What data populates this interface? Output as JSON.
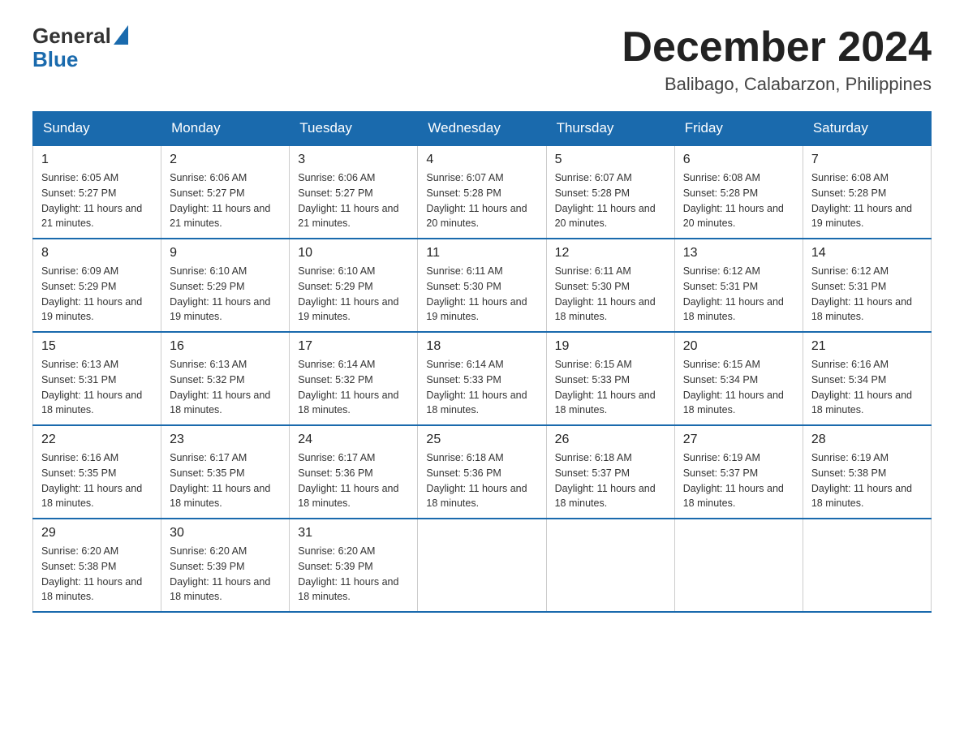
{
  "logo": {
    "general": "General",
    "triangle": "▲",
    "blue": "Blue"
  },
  "header": {
    "month": "December 2024",
    "location": "Balibago, Calabarzon, Philippines"
  },
  "weekdays": [
    "Sunday",
    "Monday",
    "Tuesday",
    "Wednesday",
    "Thursday",
    "Friday",
    "Saturday"
  ],
  "weeks": [
    [
      {
        "day": "1",
        "sunrise": "Sunrise: 6:05 AM",
        "sunset": "Sunset: 5:27 PM",
        "daylight": "Daylight: 11 hours and 21 minutes."
      },
      {
        "day": "2",
        "sunrise": "Sunrise: 6:06 AM",
        "sunset": "Sunset: 5:27 PM",
        "daylight": "Daylight: 11 hours and 21 minutes."
      },
      {
        "day": "3",
        "sunrise": "Sunrise: 6:06 AM",
        "sunset": "Sunset: 5:27 PM",
        "daylight": "Daylight: 11 hours and 21 minutes."
      },
      {
        "day": "4",
        "sunrise": "Sunrise: 6:07 AM",
        "sunset": "Sunset: 5:28 PM",
        "daylight": "Daylight: 11 hours and 20 minutes."
      },
      {
        "day": "5",
        "sunrise": "Sunrise: 6:07 AM",
        "sunset": "Sunset: 5:28 PM",
        "daylight": "Daylight: 11 hours and 20 minutes."
      },
      {
        "day": "6",
        "sunrise": "Sunrise: 6:08 AM",
        "sunset": "Sunset: 5:28 PM",
        "daylight": "Daylight: 11 hours and 20 minutes."
      },
      {
        "day": "7",
        "sunrise": "Sunrise: 6:08 AM",
        "sunset": "Sunset: 5:28 PM",
        "daylight": "Daylight: 11 hours and 19 minutes."
      }
    ],
    [
      {
        "day": "8",
        "sunrise": "Sunrise: 6:09 AM",
        "sunset": "Sunset: 5:29 PM",
        "daylight": "Daylight: 11 hours and 19 minutes."
      },
      {
        "day": "9",
        "sunrise": "Sunrise: 6:10 AM",
        "sunset": "Sunset: 5:29 PM",
        "daylight": "Daylight: 11 hours and 19 minutes."
      },
      {
        "day": "10",
        "sunrise": "Sunrise: 6:10 AM",
        "sunset": "Sunset: 5:29 PM",
        "daylight": "Daylight: 11 hours and 19 minutes."
      },
      {
        "day": "11",
        "sunrise": "Sunrise: 6:11 AM",
        "sunset": "Sunset: 5:30 PM",
        "daylight": "Daylight: 11 hours and 19 minutes."
      },
      {
        "day": "12",
        "sunrise": "Sunrise: 6:11 AM",
        "sunset": "Sunset: 5:30 PM",
        "daylight": "Daylight: 11 hours and 18 minutes."
      },
      {
        "day": "13",
        "sunrise": "Sunrise: 6:12 AM",
        "sunset": "Sunset: 5:31 PM",
        "daylight": "Daylight: 11 hours and 18 minutes."
      },
      {
        "day": "14",
        "sunrise": "Sunrise: 6:12 AM",
        "sunset": "Sunset: 5:31 PM",
        "daylight": "Daylight: 11 hours and 18 minutes."
      }
    ],
    [
      {
        "day": "15",
        "sunrise": "Sunrise: 6:13 AM",
        "sunset": "Sunset: 5:31 PM",
        "daylight": "Daylight: 11 hours and 18 minutes."
      },
      {
        "day": "16",
        "sunrise": "Sunrise: 6:13 AM",
        "sunset": "Sunset: 5:32 PM",
        "daylight": "Daylight: 11 hours and 18 minutes."
      },
      {
        "day": "17",
        "sunrise": "Sunrise: 6:14 AM",
        "sunset": "Sunset: 5:32 PM",
        "daylight": "Daylight: 11 hours and 18 minutes."
      },
      {
        "day": "18",
        "sunrise": "Sunrise: 6:14 AM",
        "sunset": "Sunset: 5:33 PM",
        "daylight": "Daylight: 11 hours and 18 minutes."
      },
      {
        "day": "19",
        "sunrise": "Sunrise: 6:15 AM",
        "sunset": "Sunset: 5:33 PM",
        "daylight": "Daylight: 11 hours and 18 minutes."
      },
      {
        "day": "20",
        "sunrise": "Sunrise: 6:15 AM",
        "sunset": "Sunset: 5:34 PM",
        "daylight": "Daylight: 11 hours and 18 minutes."
      },
      {
        "day": "21",
        "sunrise": "Sunrise: 6:16 AM",
        "sunset": "Sunset: 5:34 PM",
        "daylight": "Daylight: 11 hours and 18 minutes."
      }
    ],
    [
      {
        "day": "22",
        "sunrise": "Sunrise: 6:16 AM",
        "sunset": "Sunset: 5:35 PM",
        "daylight": "Daylight: 11 hours and 18 minutes."
      },
      {
        "day": "23",
        "sunrise": "Sunrise: 6:17 AM",
        "sunset": "Sunset: 5:35 PM",
        "daylight": "Daylight: 11 hours and 18 minutes."
      },
      {
        "day": "24",
        "sunrise": "Sunrise: 6:17 AM",
        "sunset": "Sunset: 5:36 PM",
        "daylight": "Daylight: 11 hours and 18 minutes."
      },
      {
        "day": "25",
        "sunrise": "Sunrise: 6:18 AM",
        "sunset": "Sunset: 5:36 PM",
        "daylight": "Daylight: 11 hours and 18 minutes."
      },
      {
        "day": "26",
        "sunrise": "Sunrise: 6:18 AM",
        "sunset": "Sunset: 5:37 PM",
        "daylight": "Daylight: 11 hours and 18 minutes."
      },
      {
        "day": "27",
        "sunrise": "Sunrise: 6:19 AM",
        "sunset": "Sunset: 5:37 PM",
        "daylight": "Daylight: 11 hours and 18 minutes."
      },
      {
        "day": "28",
        "sunrise": "Sunrise: 6:19 AM",
        "sunset": "Sunset: 5:38 PM",
        "daylight": "Daylight: 11 hours and 18 minutes."
      }
    ],
    [
      {
        "day": "29",
        "sunrise": "Sunrise: 6:20 AM",
        "sunset": "Sunset: 5:38 PM",
        "daylight": "Daylight: 11 hours and 18 minutes."
      },
      {
        "day": "30",
        "sunrise": "Sunrise: 6:20 AM",
        "sunset": "Sunset: 5:39 PM",
        "daylight": "Daylight: 11 hours and 18 minutes."
      },
      {
        "day": "31",
        "sunrise": "Sunrise: 6:20 AM",
        "sunset": "Sunset: 5:39 PM",
        "daylight": "Daylight: 11 hours and 18 minutes."
      },
      null,
      null,
      null,
      null
    ]
  ]
}
